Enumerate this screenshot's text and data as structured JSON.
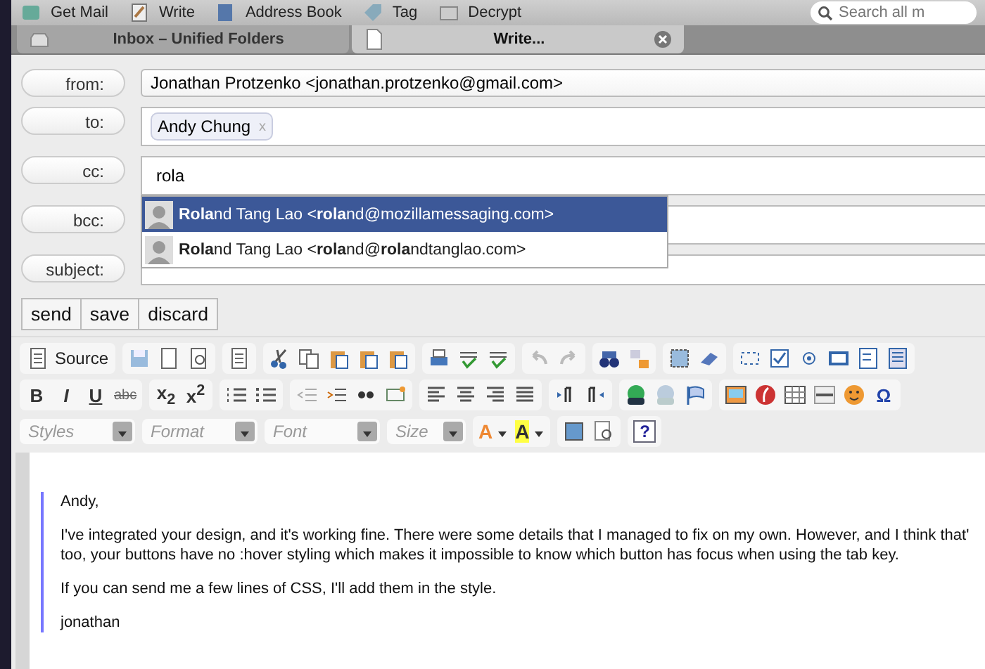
{
  "top_toolbar": {
    "items": [
      {
        "label": "Get Mail"
      },
      {
        "label": "Write"
      },
      {
        "label": "Address Book"
      },
      {
        "label": "Tag"
      },
      {
        "label": "Decrypt"
      }
    ],
    "search": {
      "placeholder": "Search all m"
    }
  },
  "tabs": [
    {
      "label": "Inbox – Unified Folders",
      "selected": false
    },
    {
      "label": "Write...",
      "selected": true
    }
  ],
  "fields": [
    {
      "label": "from:",
      "kind": "select",
      "value": "Jonathan Protzenko <jonathan.protzenko@gmail.com>"
    },
    {
      "label": "to:",
      "kind": "recipients",
      "chips": [
        "Andy Chung"
      ],
      "chip_remove": "x"
    },
    {
      "label": "cc:",
      "kind": "text",
      "value": "rola"
    },
    {
      "label": "bcc:",
      "kind": "text"
    },
    {
      "label": "subject:",
      "kind": "text"
    }
  ],
  "suggestions": [
    {
      "text": "**Rola**nd Tang Lao <**rola**nd@mozillamessaging.com>",
      "selected": true
    },
    {
      "text": "**Rola**nd Tang Lao <**rola**nd@**rola**ndtanglao.com>",
      "selected": false
    }
  ],
  "actions": [
    "send",
    "save",
    "discard"
  ],
  "editor": {
    "source_label": "Source",
    "format_buttons": [
      {
        "label": "B",
        "kind": "bold"
      },
      {
        "label": "I",
        "kind": "italic"
      },
      {
        "label": "U",
        "kind": "underline"
      },
      {
        "label": "abc",
        "kind": "strike"
      }
    ],
    "script_buttons": [
      "x$_{2}$",
      "x$^{2}$"
    ],
    "symbol_label": "Ω",
    "combos": [
      {
        "placeholder": "Styles"
      },
      {
        "placeholder": "Format"
      },
      {
        "placeholder": "Font"
      },
      {
        "placeholder": "Size"
      }
    ],
    "color_buttons": [
      {
        "label": "A",
        "kind": "text"
      },
      {
        "label": "A",
        "kind": "background"
      }
    ],
    "help_label": "?",
    "paragraphs": [
      {
        "lines": [
          "Andy,"
        ]
      },
      {
        "lines": [
          "I've integrated your design, and it's working fine. There were some details that I managed to fix on my own. However, and I think that'",
          "too, your buttons have no :hover styling which makes it impossible to know which button has focus when using the tab key."
        ]
      },
      {
        "lines": [
          "If you can send me a few lines of CSS, I'll add them in the style."
        ]
      },
      {
        "lines": [
          "jonathan"
        ]
      }
    ]
  }
}
